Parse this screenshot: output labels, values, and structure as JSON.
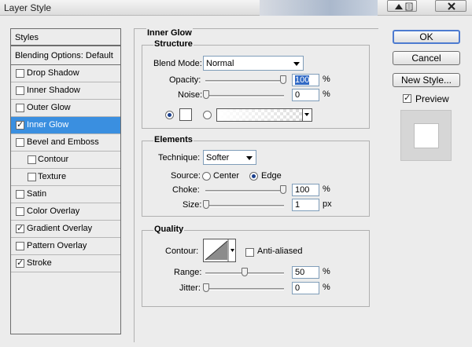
{
  "window": {
    "title": "Layer Style"
  },
  "sidebar": {
    "header": "Styles",
    "blending": "Blending Options: Default",
    "items": [
      {
        "label": "Drop Shadow",
        "checked": false,
        "indent": false,
        "selected": false
      },
      {
        "label": "Inner Shadow",
        "checked": false,
        "indent": false,
        "selected": false
      },
      {
        "label": "Outer Glow",
        "checked": false,
        "indent": false,
        "selected": false
      },
      {
        "label": "Inner Glow",
        "checked": true,
        "indent": false,
        "selected": true
      },
      {
        "label": "Bevel and Emboss",
        "checked": false,
        "indent": false,
        "selected": false
      },
      {
        "label": "Contour",
        "checked": false,
        "indent": true,
        "selected": false
      },
      {
        "label": "Texture",
        "checked": false,
        "indent": true,
        "selected": false
      },
      {
        "label": "Satin",
        "checked": false,
        "indent": false,
        "selected": false
      },
      {
        "label": "Color Overlay",
        "checked": false,
        "indent": false,
        "selected": false
      },
      {
        "label": "Gradient Overlay",
        "checked": true,
        "indent": false,
        "selected": false
      },
      {
        "label": "Pattern Overlay",
        "checked": false,
        "indent": false,
        "selected": false
      },
      {
        "label": "Stroke",
        "checked": true,
        "indent": false,
        "selected": false
      }
    ]
  },
  "inner_glow": {
    "title": "Inner Glow",
    "structure": {
      "title": "Structure",
      "blend_mode_label": "Blend Mode:",
      "blend_mode": "Normal",
      "opacity_label": "Opacity:",
      "opacity": "100",
      "opacity_unit": "%",
      "noise_label": "Noise:",
      "noise": "0",
      "noise_unit": "%"
    },
    "elements": {
      "title": "Elements",
      "technique_label": "Technique:",
      "technique": "Softer",
      "source_label": "Source:",
      "source_center": "Center",
      "source_edge": "Edge",
      "choke_label": "Choke:",
      "choke": "100",
      "choke_unit": "%",
      "size_label": "Size:",
      "size": "1",
      "size_unit": "px"
    },
    "quality": {
      "title": "Quality",
      "contour_label": "Contour:",
      "anti_aliased": "Anti-aliased",
      "range_label": "Range:",
      "range": "50",
      "range_unit": "%",
      "jitter_label": "Jitter:",
      "jitter": "0",
      "jitter_unit": "%"
    }
  },
  "buttons": {
    "ok": "OK",
    "cancel": "Cancel",
    "new_style": "New Style..."
  },
  "preview": {
    "label": "Preview",
    "checked": true
  },
  "colors": {
    "selection": "#3a8fe0",
    "focus_border": "#4d7bd0"
  }
}
